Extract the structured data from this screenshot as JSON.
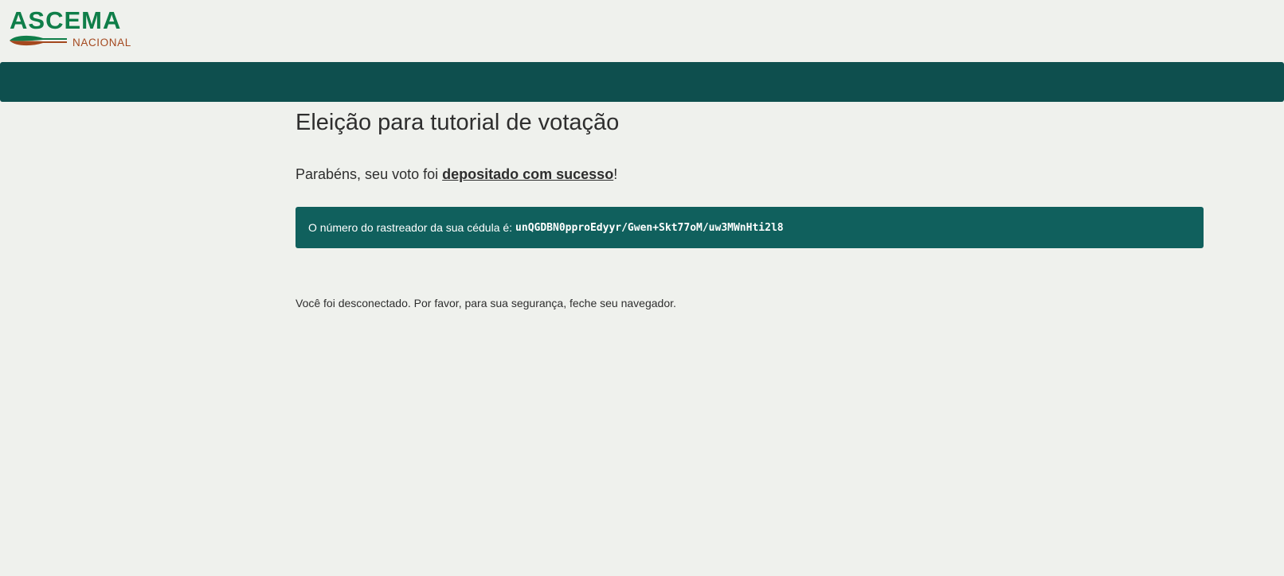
{
  "brand": {
    "name": "ASCEMA",
    "subtitle": "NACIONAL",
    "colors": {
      "green": "#0f7e49",
      "brown": "#a4481e",
      "nav": "#0e4f4e",
      "alert": "#10605d"
    }
  },
  "page": {
    "title": "Eleição para tutorial de votação"
  },
  "confirmation": {
    "prefix": "Parabéns, seu voto foi ",
    "link_label": "depositado com sucesso",
    "suffix": "!"
  },
  "tracker": {
    "label": "O número do rastreador da sua cédula é:",
    "code": "unQGDBN0pproEdyyr/Gwen+Skt77oM/uw3MWnHti2l8"
  },
  "logout_note": "Você foi desconectado. Por favor, para sua segurança, feche seu navegador."
}
